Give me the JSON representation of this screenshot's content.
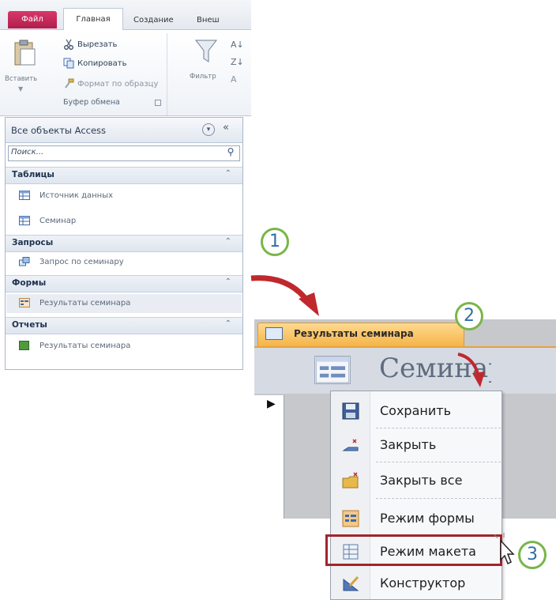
{
  "ribbon": {
    "tabs": [
      "Файл",
      "Главная",
      "Создание",
      "Внеш"
    ],
    "clipboard": {
      "paste_label": "Вставить",
      "cut_label": "Вырезать",
      "copy_label": "Копировать",
      "format_painter_label": "Формат по образцу",
      "group_title": "Буфер обмена"
    },
    "filter_label": "Фильтр"
  },
  "nav_pane": {
    "title": "Все объекты Access",
    "collapse_glyph": "«",
    "search_placeholder": "Поиск...",
    "groups": [
      {
        "label": "Таблицы",
        "items": [
          "Источник данных",
          "Семинар"
        ]
      },
      {
        "label": "Запросы",
        "items": [
          "Запрос по семинару"
        ]
      },
      {
        "label": "Формы",
        "items": [
          "Результаты семинара"
        ]
      },
      {
        "label": "Отчеты",
        "items": [
          "Результаты семинара"
        ]
      }
    ]
  },
  "callouts": [
    "1",
    "2",
    "3"
  ],
  "document": {
    "tab_label": "Результаты семинара",
    "form_title": "Семинар"
  },
  "context_menu": {
    "items": [
      "Сохранить",
      "Закрыть",
      "Закрыть все",
      "Режим формы",
      "Режим макета",
      "Конструктор"
    ],
    "highlighted": "Режим макета"
  },
  "colors": {
    "callout_ring": "#79b649",
    "callout_digit": "#2f6fa6",
    "arrow": "#c0282d",
    "tab_orange": "#f5b44a",
    "highlight_border": "#a0252c"
  }
}
